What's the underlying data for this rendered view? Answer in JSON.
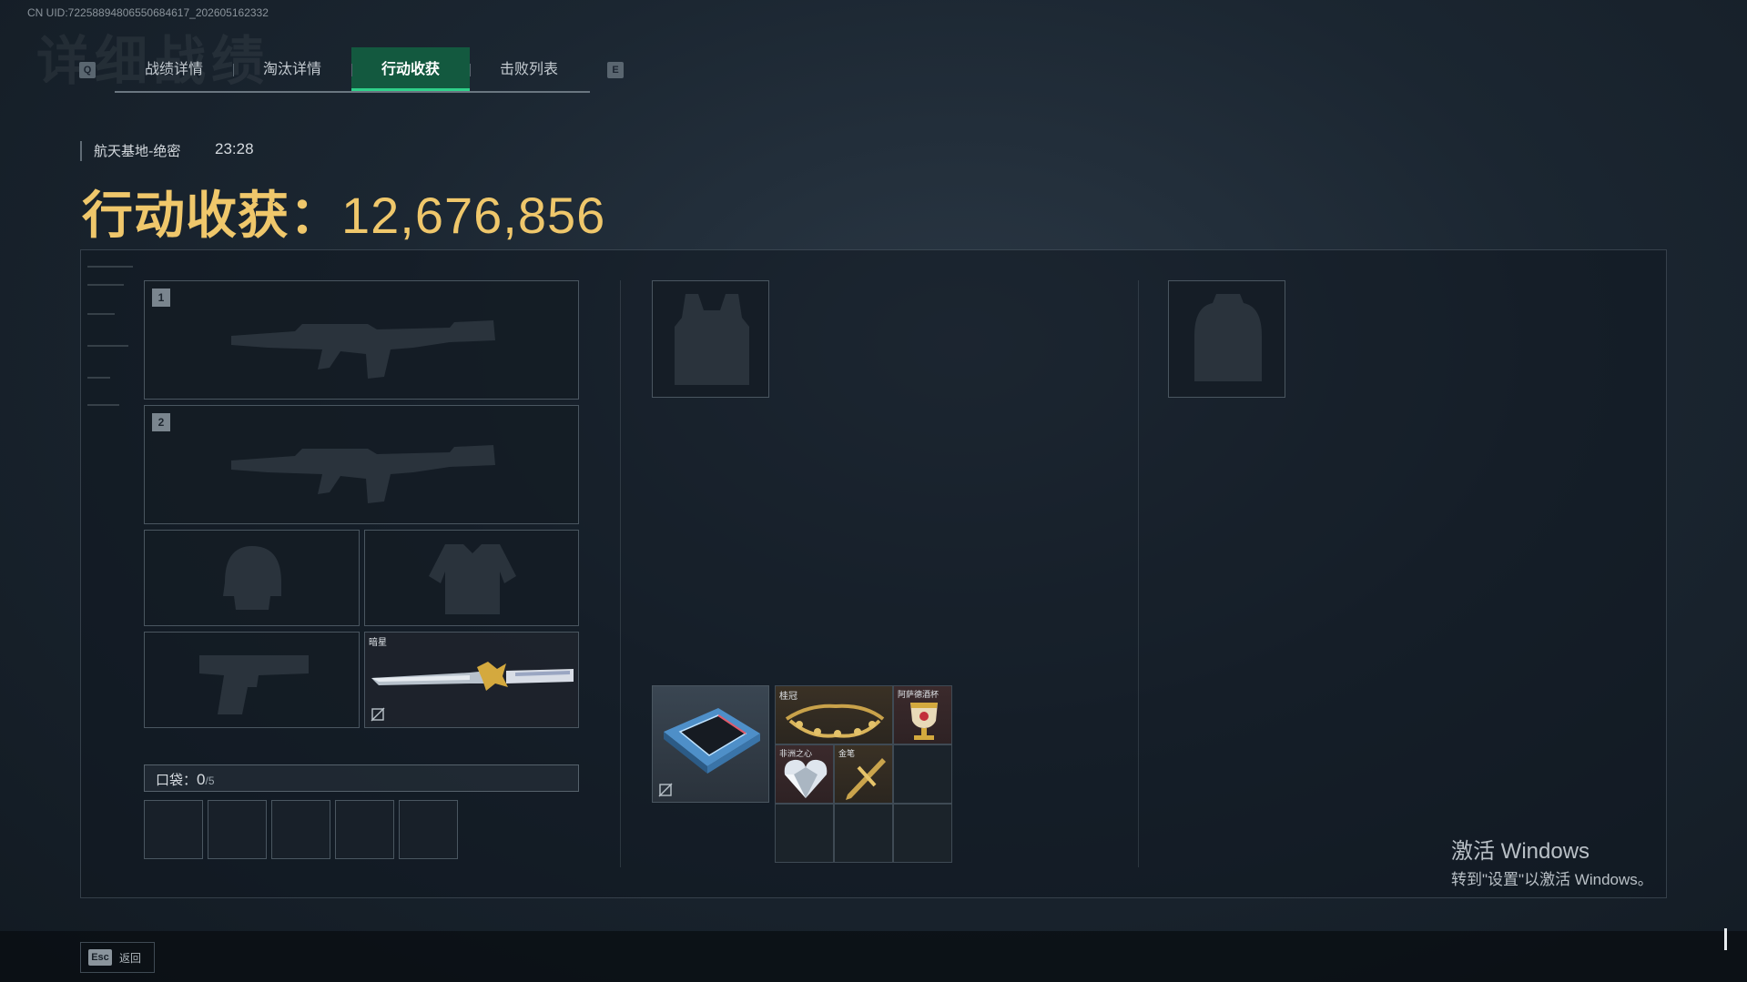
{
  "uid_text": "CN UID:72258894806550684617_202605162332",
  "background_title": "详细战绩",
  "tabs": {
    "left_key": "Q",
    "right_key": "E",
    "items": [
      {
        "label": "战绩详情"
      },
      {
        "label": "淘汰详情"
      },
      {
        "label": "行动收获",
        "active": true
      },
      {
        "label": "击败列表"
      }
    ]
  },
  "mission": {
    "location": "航天基地-绝密",
    "time": "23:28"
  },
  "haul": {
    "label": "行动收获：",
    "value": "12,676,856"
  },
  "loadout": {
    "slot1_number": "1",
    "slot2_number": "2",
    "melee_name": "暗星"
  },
  "pocket": {
    "label": "口袋：",
    "count": "0",
    "total": "/5"
  },
  "loot": {
    "items": [
      {
        "name": "桂冠",
        "color": "#c9a24a"
      },
      {
        "name": "阿萨德酒杯",
        "color": "#d4b25a"
      },
      {
        "name": "非洲之心",
        "color": "#dfe6ee"
      },
      {
        "name": "金笔",
        "color": "#caa44c"
      }
    ]
  },
  "windows_activation": {
    "line1": "激活 Windows",
    "line2": "转到\"设置\"以激活 Windows。"
  },
  "footer": {
    "esc_key": "Esc",
    "back_label": "返回"
  },
  "colors": {
    "accent_gold": "#efc76b",
    "active_tab_bg": "#13593f",
    "active_tab_border": "#2fd08a"
  }
}
